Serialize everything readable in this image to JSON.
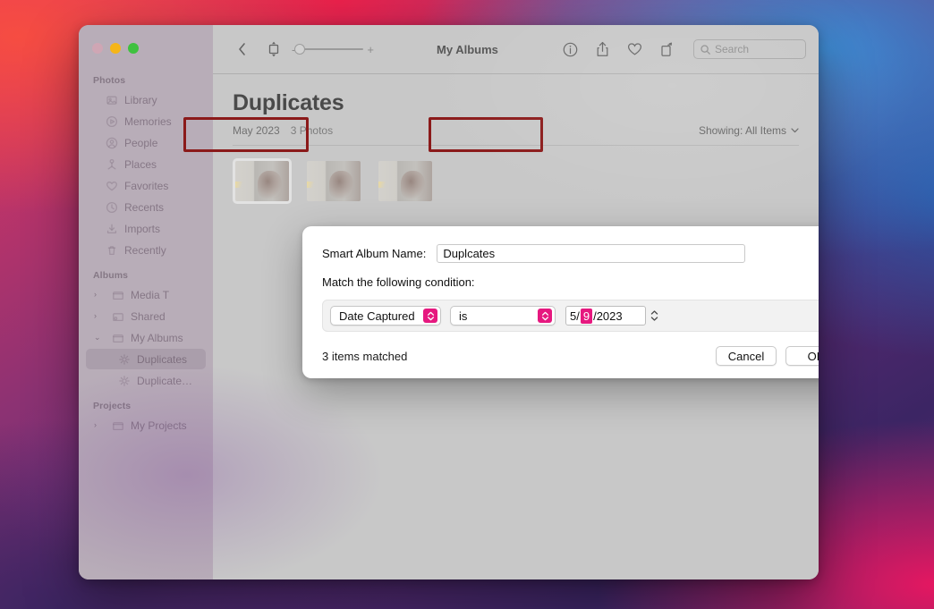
{
  "window": {
    "traffic_lights": [
      "close",
      "minimize",
      "zoom"
    ]
  },
  "sidebar": {
    "sections": [
      {
        "title": "Photos",
        "items": [
          {
            "label": "Library",
            "icon": "photos-library-icon",
            "disclosure": ""
          },
          {
            "label": "Memories",
            "icon": "memories-icon",
            "disclosure": ""
          },
          {
            "label": "People",
            "icon": "people-icon",
            "disclosure": ""
          },
          {
            "label": "Places",
            "icon": "places-pin-icon",
            "disclosure": ""
          },
          {
            "label": "Favorites",
            "icon": "heart-icon",
            "disclosure": ""
          },
          {
            "label": "Recents",
            "icon": "clock-icon",
            "disclosure": ""
          },
          {
            "label": "Imports",
            "icon": "import-icon",
            "disclosure": ""
          },
          {
            "label": "Recently",
            "icon": "trash-icon",
            "disclosure": ""
          }
        ]
      },
      {
        "title": "Albums",
        "items": [
          {
            "label": "Media T",
            "icon": "folder-icon",
            "disclosure": "›"
          },
          {
            "label": "Shared",
            "icon": "shared-folder-icon",
            "disclosure": "›"
          },
          {
            "label": "My Albums",
            "icon": "folder-icon",
            "disclosure": "⌄"
          },
          {
            "label": "Duplicates",
            "icon": "smart-album-icon",
            "disclosure": "",
            "nested": true,
            "selected": true
          },
          {
            "label": "Duplicate…",
            "icon": "smart-album-icon",
            "disclosure": "",
            "nested": true
          }
        ]
      },
      {
        "title": "Projects",
        "items": [
          {
            "label": "My Projects",
            "icon": "folder-icon",
            "disclosure": "›"
          }
        ]
      }
    ]
  },
  "toolbar": {
    "back_icon": "chevron-left-icon",
    "resize_icon": "aspect-resize-icon",
    "zoom_out_label": "-",
    "zoom_in_label": "+",
    "title": "My Albums",
    "info_icon": "info-circle-icon",
    "share_icon": "share-icon",
    "favorite_icon": "heart-icon",
    "rotate_icon": "rotate-icon",
    "search_icon": "search-icon",
    "search_placeholder": "Search",
    "search_value": ""
  },
  "page": {
    "title": "Duplicates",
    "date": "May 2023",
    "count": "3 Photos",
    "showing_label": "Showing: All Items",
    "showing_chevron": "chevron-down-icon",
    "thumbnails": [
      {
        "selected": true
      },
      {
        "selected": false
      },
      {
        "selected": false
      }
    ]
  },
  "dialog": {
    "name_label": "Smart Album Name:",
    "name_value": "Duplcates",
    "name_placeholder": "",
    "match_label": "Match the following condition:",
    "condition": {
      "attribute_value": "Date Captured",
      "operator_value": "is",
      "date_month": "5/",
      "date_day": "9",
      "date_year": "/2023",
      "stepper_icon": "stepper-up-down-icon",
      "add_label": "+"
    },
    "matched_text": "3 items matched",
    "cancel_label": "Cancel",
    "ok_label": "OK"
  },
  "annotations": {
    "highlight_color": "#8b1a1a",
    "accent_color": "#e6187f"
  }
}
